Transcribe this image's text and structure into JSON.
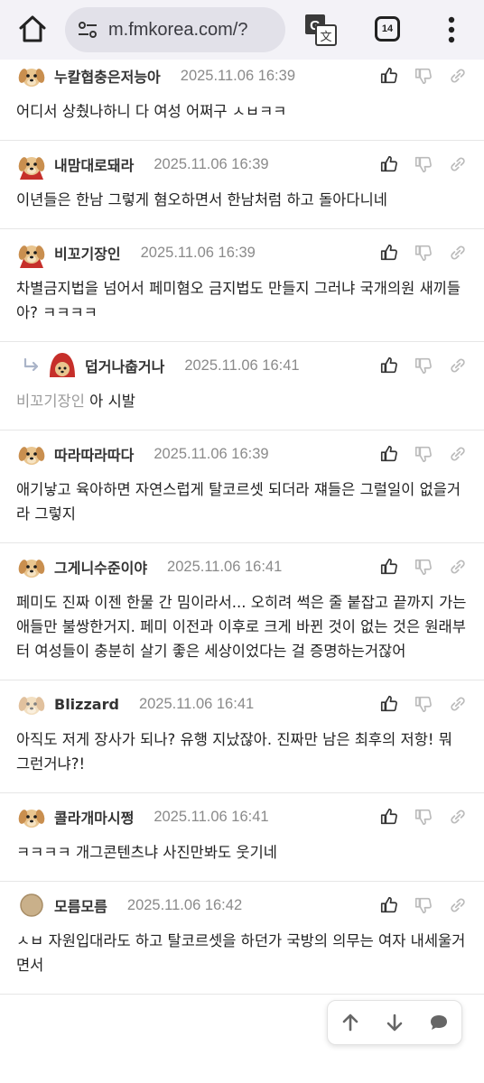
{
  "browser": {
    "url": "m.fmkorea.com/?",
    "tab_count": "14"
  },
  "comments": [
    {
      "nick": "누칼협충은저능아",
      "date": "2025.11.06 16:39",
      "avatar": "puppy",
      "text": "어디서 상췄나하니 다 여성 어쩌구 ㅅㅂㅋㅋ"
    },
    {
      "nick": "내맘대로돼라",
      "date": "2025.11.06 16:39",
      "avatar": "puppy-red",
      "text": "이년들은 한남 그렇게 혐오하면서 한남처럼 하고 돌아다니네"
    },
    {
      "nick": "비꼬기장인",
      "date": "2025.11.06 16:39",
      "avatar": "puppy-red",
      "text": "차별금지법을 넘어서 페미혐오 금지법도 만들지 그러냐 국개의원 새끼들아? ㅋㅋㅋㅋ"
    },
    {
      "nick": "덥거나춥거나",
      "date": "2025.11.06 16:41",
      "avatar": "puppy-hood",
      "reply_to": "비꼬기장인",
      "text": "아 시발"
    },
    {
      "nick": "따라따라따다",
      "date": "2025.11.06 16:39",
      "avatar": "puppy",
      "text": "애기낳고 육아하면 자연스럽게 탈코르셋 되더라 쟤들은 그럴일이 없을거라 그렇지"
    },
    {
      "nick": "그게니수준이야",
      "date": "2025.11.06 16:41",
      "avatar": "puppy",
      "text": "페미도 진짜 이젠 한물 간 밈이라서... 오히려 썩은 줄 붙잡고 끝까지 가는 애들만 불쌍한거지. 페미 이전과 이후로 크게 바뀐 것이 없는 것은 원래부터 여성들이 충분히 살기 좋은 세상이었다는 걸 증명하는거잖어"
    },
    {
      "nick": "Blizzard",
      "date": "2025.11.06 16:41",
      "avatar": "puppy-blur",
      "text": "아직도 저게 장사가 되나? 유행 지났잖아. 진짜만 남은 최후의 저항! 뭐 그런거냐?!"
    },
    {
      "nick": "콜라개마시쩡",
      "date": "2025.11.06 16:41",
      "avatar": "puppy",
      "text": "ㅋㅋㅋㅋ 개그콘텐츠냐 사진만봐도 웃기네"
    },
    {
      "nick": "모름모름",
      "date": "2025.11.06 16:42",
      "avatar": "plain",
      "text": "ㅅㅂ 자원입대라도 하고 탈코르셋을 하던가 국방의 의무는 여자 내세울거면서"
    }
  ],
  "colors": {
    "topbar_bg": "#f3f2f7",
    "url_bg": "#e2e1e9",
    "date_text": "#8a8a8a",
    "divider": "#e6e6e6"
  },
  "icons": {
    "home": "home-icon",
    "site_settings": "site-settings-icon",
    "translate": "translate-icon",
    "menu": "more-vert-icon",
    "like": "thumbs-up-icon",
    "dislike": "thumbs-down-icon",
    "link": "link-icon",
    "scroll_up": "arrow-up-icon",
    "scroll_down": "arrow-down-icon",
    "chat": "chat-bubble-icon"
  }
}
